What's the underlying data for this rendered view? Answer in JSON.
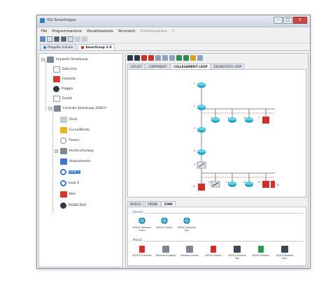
{
  "window": {
    "title": "ISS Smartlogos"
  },
  "window_buttons": [
    "–",
    "□",
    "×"
  ],
  "menu": {
    "items": [
      "File",
      "Programmazione",
      "Visualizzazione",
      "Strumenti"
    ],
    "dim_items": [
      "Comunicazione",
      "?"
    ]
  },
  "tabs": [
    {
      "label": "Progetto Iniziale",
      "active": false
    },
    {
      "label": "SmartLoop 2.0",
      "active": true
    }
  ],
  "tree": {
    "items": [
      {
        "label": "Impianto SmartLoop",
        "level": 0,
        "icon": "gray"
      },
      {
        "label": "Data Ora",
        "level": 1,
        "icon": "white"
      },
      {
        "label": "Festività",
        "level": 1,
        "icon": "red"
      },
      {
        "label": "Piaggio",
        "level": 1,
        "icon": "net"
      },
      {
        "label": "Eventi",
        "level": 1,
        "icon": "white"
      },
      {
        "label": "Centrale SmartLoop 2000 P",
        "level": 1,
        "icon": "gray"
      },
      {
        "label": "Zone",
        "level": 2,
        "icon": "star"
      },
      {
        "label": "Curve/Blindo",
        "level": 2,
        "icon": "yellow"
      },
      {
        "label": "Timers",
        "level": 2,
        "icon": "clock"
      },
      {
        "label": "Periferiche/loop",
        "level": 2,
        "icon": "gray"
      },
      {
        "label": "Ampliamento",
        "level": 2,
        "icon": "blue"
      },
      {
        "label": "Loop 1",
        "level": 2,
        "icon": "ring",
        "selected": true
      },
      {
        "label": "Loop 2",
        "level": 2,
        "icon": "ring"
      },
      {
        "label": "Reti",
        "level": 2,
        "icon": "red"
      },
      {
        "label": "RS485 BUS",
        "level": 2,
        "icon": "net"
      }
    ]
  },
  "view_tabs": [
    {
      "label": "CIRCUITI",
      "active": false
    },
    {
      "label": "COMPONENTI",
      "active": false
    },
    {
      "label": "COLLEGAMENTI LOOP",
      "active": true
    },
    {
      "label": "DIAGNOSTICA LOOP",
      "active": false
    }
  ],
  "diagram": {
    "node_labels": [
      "1",
      "2",
      "3",
      "4",
      "5",
      "6",
      "7",
      "8",
      "9",
      "10",
      "11",
      "12",
      "13",
      "14",
      "15"
    ]
  },
  "bottom_tabs": [
    {
      "label": "MODULI",
      "active": false
    },
    {
      "label": "SIRENE",
      "active": false
    },
    {
      "label": "ZONE",
      "active": true
    }
  ],
  "palette": {
    "group1_title": "Sensori",
    "group1": [
      {
        "label": "ID310 Sensore fumo",
        "icon": "cam"
      },
      {
        "label": "ID310 Calore",
        "icon": "cam"
      },
      {
        "label": "ID310 Sensore Ott.",
        "icon": "cam"
      }
    ],
    "group2_title": "Moduli",
    "group2": [
      {
        "label": "ID310 Pulsante",
        "icon": "red"
      },
      {
        "label": "Modulo Ingressi",
        "icon": "gray"
      },
      {
        "label": "Modulo Uscite",
        "icon": "gray"
      },
      {
        "label": "ID310 Sirena",
        "icon": "red"
      },
      {
        "label": "ID310 Modulo Ing.",
        "icon": "dark"
      },
      {
        "label": "ID310 Modulo",
        "icon": "green"
      },
      {
        "label": "ID310 Modulo Zon.",
        "icon": "dark"
      }
    ]
  }
}
